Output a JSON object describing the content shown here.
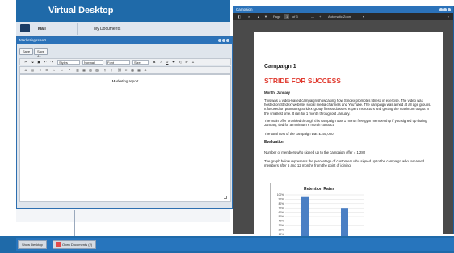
{
  "desktop": {
    "title": "Virtual Desktop",
    "mail_label": "Mail",
    "mydocs_label": "My Documents"
  },
  "editor": {
    "title": "Marketing report",
    "save_label": "Save",
    "save_as_label": "Save As",
    "styles_dropdown": "Styles",
    "format_dropdown": "Normal",
    "font_dropdown": "Font",
    "size_dropdown": "Size",
    "document_text": "Marketing report"
  },
  "pdf": {
    "title": "Campaign",
    "page_label": "Page",
    "page_current": "1",
    "page_total": "of 3",
    "zoom_label": "Automatic Zoom",
    "heading": "Campaign 1",
    "subheading": "STRIDE FOR SUCCESS",
    "month_line": "Month: January",
    "para1": "This was a video-based campaign showcasing how Stridex promotes fitness in exercise. The video was hosted on Stridex' website, social media channels and YouTube. The campaign was aimed at all age groups. It focused on promoting Stridex' group fitness classes, expert instructors and getting the maximum output in the smallest time. It ran for 1 month throughout January.",
    "para2": "The main offer provided through this campaign was 1 month free gym membership if you signed up during January, tied for a minimum 6 month contract.",
    "para3": "The total cost of the campaign was £150,000.",
    "evaluation_heading": "Evaluation",
    "para4": "Number of members who signed up to the campaign offer = 1,280",
    "para5": "The graph below represents the percentage of customers who signed up to the campaign who remained members after 6 and 12 months from the point of joining."
  },
  "chart_data": {
    "type": "bar",
    "title": "Retention Rates",
    "categories": [
      "6 months",
      "12 months"
    ],
    "values": [
      95,
      70
    ],
    "yticks": [
      "0%",
      "10%",
      "20%",
      "30%",
      "40%",
      "50%",
      "60%",
      "70%",
      "80%",
      "90%",
      "100%"
    ],
    "ylim": [
      0,
      100
    ],
    "color": "#4a7fc4",
    "grid": true
  },
  "taskbar": {
    "show_desktop": "Show Desktop",
    "open_documents": "Open Documents (2)"
  }
}
